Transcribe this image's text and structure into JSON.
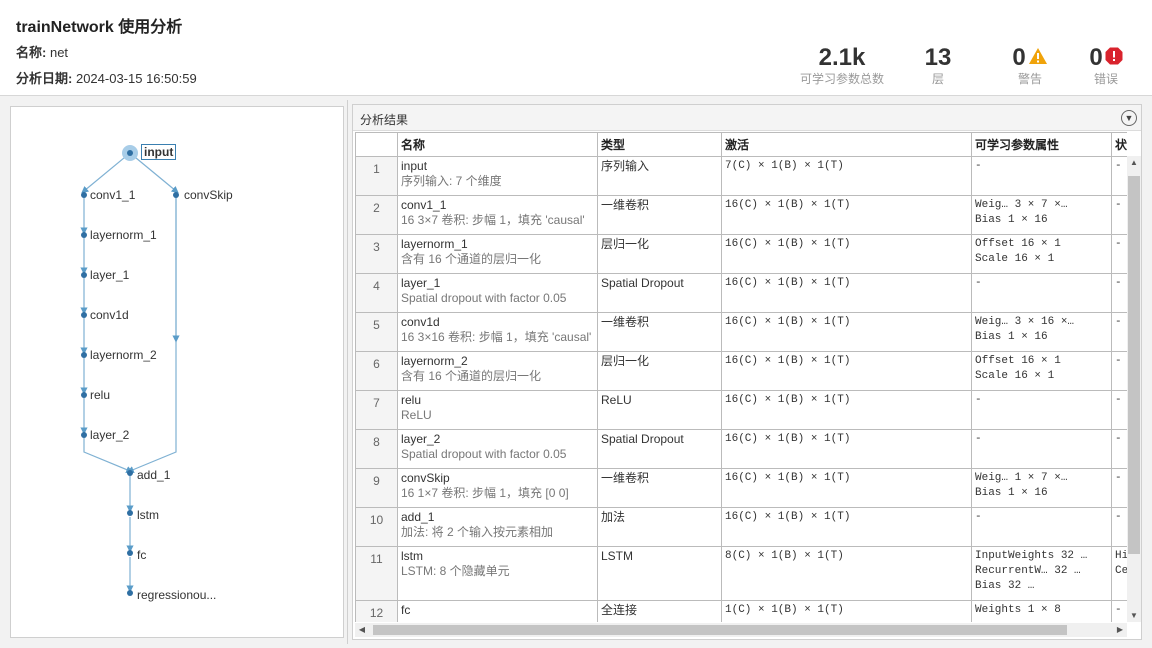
{
  "header": {
    "title": "trainNetwork 使用分析",
    "name_label": "名称:",
    "name_value": "net",
    "date_label": "分析日期:",
    "date_value": "2024-03-15 16:50:59",
    "stats": {
      "params_value": "2.1k",
      "params_label": "可学习参数总数",
      "layers_value": "13",
      "layers_label": "层",
      "warnings_value": "0",
      "warnings_label": "警告",
      "errors_value": "0",
      "errors_label": "错误"
    },
    "colors": {
      "warning": "#f0a30a",
      "error": "#d9232d",
      "accent": "#3a7fb0"
    }
  },
  "graph": {
    "nodes": [
      "input",
      "conv1_1",
      "convSkip",
      "layernorm_1",
      "layer_1",
      "conv1d",
      "layernorm_2",
      "relu",
      "layer_2",
      "add_1",
      "lstm",
      "fc",
      "regressionou..."
    ],
    "selected": "input"
  },
  "results": {
    "title": "分析结果",
    "columns": [
      "名称",
      "类型",
      "激活",
      "可学习参数属性",
      "状"
    ],
    "rows": [
      {
        "n": "1",
        "name": "input",
        "desc": "序列输入: 7 个维度",
        "type": "序列输入",
        "act": "7(C) × 1(B) × 1(T)",
        "p": [
          "-"
        ],
        "s": [
          "-"
        ]
      },
      {
        "n": "2",
        "name": "conv1_1",
        "desc": "16 3×7 卷积: 步幅 1，填充 'causal'",
        "type": "一维卷积",
        "act": "16(C) × 1(B) × 1(T)",
        "p": [
          "Weig… 3 × 7 ×…",
          "Bias   1 × 16"
        ],
        "s": [
          "-"
        ]
      },
      {
        "n": "3",
        "name": "layernorm_1",
        "desc": "含有 16 个通道的层归一化",
        "type": "层归一化",
        "act": "16(C) × 1(B) × 1(T)",
        "p": [
          "Offset 16 × 1",
          "Scale  16 × 1"
        ],
        "s": [
          "-"
        ]
      },
      {
        "n": "4",
        "name": "layer_1",
        "desc": "Spatial dropout with factor 0.05",
        "type": "Spatial Dropout",
        "act": "16(C) × 1(B) × 1(T)",
        "p": [
          "-"
        ],
        "s": [
          "-"
        ]
      },
      {
        "n": "5",
        "name": "conv1d",
        "desc": "16 3×16 卷积: 步幅 1，填充 'causal'",
        "type": "一维卷积",
        "act": "16(C) × 1(B) × 1(T)",
        "p": [
          "Weig… 3 × 16 ×…",
          "Bias   1 × 16"
        ],
        "s": [
          "-"
        ]
      },
      {
        "n": "6",
        "name": "layernorm_2",
        "desc": "含有 16 个通道的层归一化",
        "type": "层归一化",
        "act": "16(C) × 1(B) × 1(T)",
        "p": [
          "Offset 16 × 1",
          "Scale  16 × 1"
        ],
        "s": [
          "-"
        ]
      },
      {
        "n": "7",
        "name": "relu",
        "desc": "ReLU",
        "type": "ReLU",
        "act": "16(C) × 1(B) × 1(T)",
        "p": [
          "-"
        ],
        "s": [
          "-"
        ]
      },
      {
        "n": "8",
        "name": "layer_2",
        "desc": "Spatial dropout with factor 0.05",
        "type": "Spatial Dropout",
        "act": "16(C) × 1(B) × 1(T)",
        "p": [
          "-"
        ],
        "s": [
          "-"
        ]
      },
      {
        "n": "9",
        "name": "convSkip",
        "desc": "16 1×7 卷积: 步幅 1，填充 [0 0]",
        "type": "一维卷积",
        "act": "16(C) × 1(B) × 1(T)",
        "p": [
          "Weig… 1 × 7 ×…",
          "Bias   1 × 16"
        ],
        "s": [
          "-"
        ]
      },
      {
        "n": "10",
        "name": "add_1",
        "desc": "加法: 将 2 个输入按元素相加",
        "type": "加法",
        "act": "16(C) × 1(B) × 1(T)",
        "p": [
          "-"
        ],
        "s": [
          "-"
        ]
      },
      {
        "n": "11",
        "name": "lstm",
        "desc": "LSTM: 8 个隐藏单元",
        "type": "LSTM",
        "act": "8(C) × 1(B) × 1(T)",
        "p": [
          "InputWeights  32 …",
          "RecurrentW…   32 …",
          "Bias          32 …"
        ],
        "s": [
          "Hi",
          "Ce"
        ],
        "tall": true
      },
      {
        "n": "12",
        "name": "fc",
        "desc": "",
        "type": "全连接",
        "act": "1(C) × 1(B) × 1(T)",
        "p": [
          "Weights 1 × 8"
        ],
        "s": [
          "-"
        ]
      }
    ]
  }
}
